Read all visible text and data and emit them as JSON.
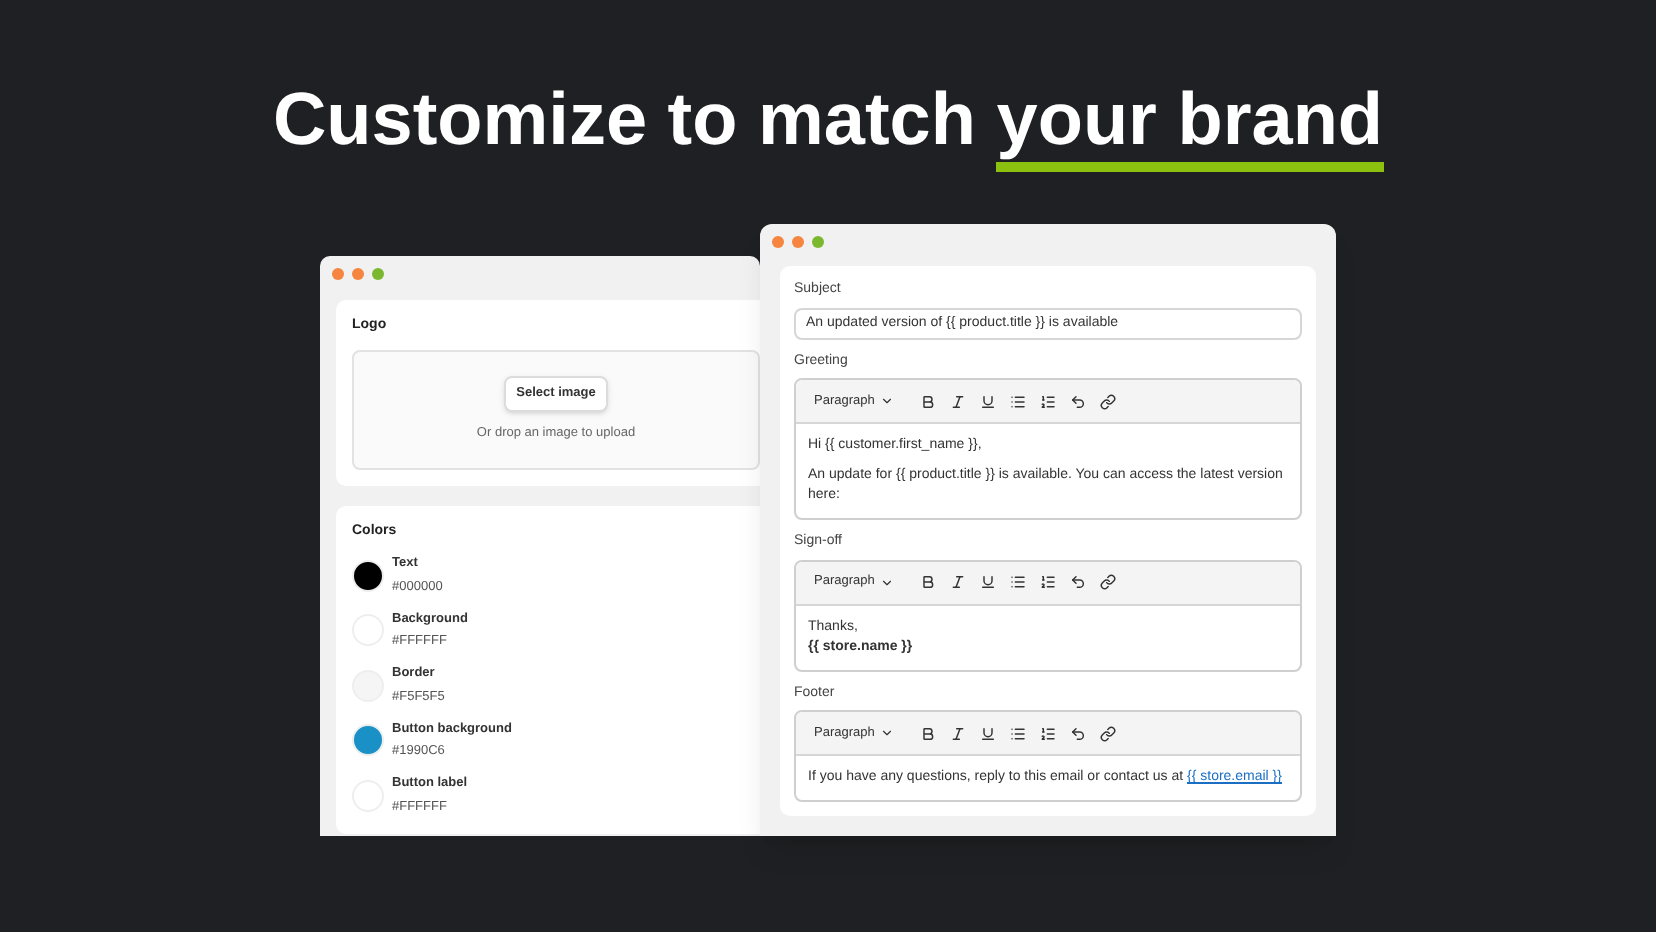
{
  "headline": {
    "text": "Customize to match ",
    "highlight": "your brand"
  },
  "brand_window": {
    "logo": {
      "label": "Logo",
      "button": "Select image",
      "hint": "Or drop an image to upload"
    },
    "colors": {
      "label": "Colors",
      "items": [
        {
          "name": "Text",
          "value": "#000000",
          "color": "#000000"
        },
        {
          "name": "Background",
          "value": "#FFFFFF",
          "color": "#ffffff"
        },
        {
          "name": "Border",
          "value": "#F5F5F5",
          "color": "#f5f5f5"
        },
        {
          "name": "Button background",
          "value": "#1990C6",
          "color": "#1990c6"
        },
        {
          "name": "Button label",
          "value": "#FFFFFF",
          "color": "#ffffff"
        }
      ]
    }
  },
  "email_window": {
    "subject": {
      "label": "Subject",
      "value": "An updated version of {{ product.title }} is available"
    },
    "editors": [
      {
        "label": "Greeting",
        "format": "Paragraph",
        "gap": true,
        "lines": [
          {
            "text": "Hi {{ customer.first_name }},",
            "bold": false
          },
          {
            "text": "An update for {{ product.title }} is available. You can access the latest version here:",
            "bold": false
          }
        ]
      },
      {
        "label": "Sign-off",
        "format": "Paragraph",
        "gap": false,
        "lines": [
          {
            "text": "Thanks,",
            "bold": false
          },
          {
            "text": "{{ store.name }}",
            "bold": true
          }
        ]
      },
      {
        "label": "Footer",
        "format": "Paragraph",
        "lines": [
          {
            "text": "If you have any questions, reply to this email or contact us at",
            "bold": false,
            "link": "{{ store.email }}"
          }
        ]
      }
    ]
  }
}
